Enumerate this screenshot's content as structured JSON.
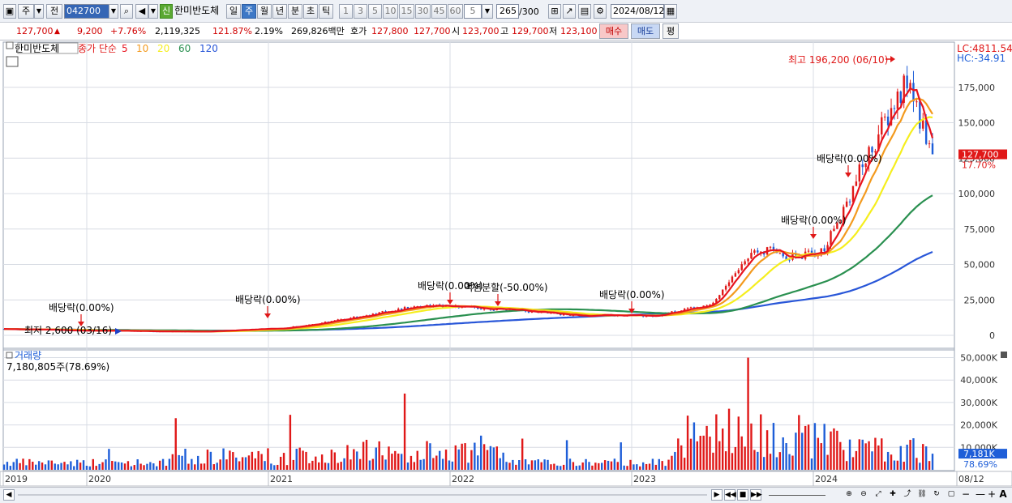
{
  "toolbar": {
    "period_type": "주",
    "prev_label": "전",
    "stock_code": "042700",
    "new_badge": "신",
    "stock_name": "한미반도체",
    "tabs": [
      "일",
      "주",
      "월",
      "년",
      "분",
      "초",
      "틱"
    ],
    "active_tab": "주",
    "intervals": [
      "1",
      "3",
      "5",
      "10",
      "15",
      "30",
      "45",
      "60"
    ],
    "interval_value": "5",
    "count_value": "265",
    "count_total": "/300",
    "date_value": "2024/08/12"
  },
  "quote": {
    "price": "127,700",
    "change": "9,200",
    "change_pct": "+7.76%",
    "volume": "2,119,325",
    "vol_ratio": "121.87%",
    "turnover": "2.19%",
    "amount": "269,826백만",
    "ask_label": "호가",
    "ask1": "127,800",
    "ask2": "127,700",
    "open_label": "시",
    "open": "123,700",
    "high_label": "고",
    "high": "129,700",
    "low_label": "저",
    "low": "123,100",
    "buy_label": "매수",
    "sell_label": "매도",
    "eval_label": "평"
  },
  "legend": {
    "stock_name": "한미반도체",
    "series_label": "종가 단순",
    "ma": [
      {
        "period": "5",
        "color": "#e8141e"
      },
      {
        "period": "10",
        "color": "#f39a1e"
      },
      {
        "period": "20",
        "color": "#f5ee1e"
      },
      {
        "period": "60",
        "color": "#2a9050"
      },
      {
        "period": "120",
        "color": "#2856d8"
      }
    ],
    "lc": "LC:4811.54",
    "hc": "HC:-34.91",
    "volume_title": "거래량",
    "volume_value": "7,180,805주(78.69%)"
  },
  "chart_data": {
    "type": "candlestick",
    "price_axis": {
      "min": 0,
      "max": 200000,
      "ticks": [
        "175,000",
        "150,000",
        "125,000",
        "100,000",
        "75,000",
        "50,000",
        "25,000",
        "0"
      ],
      "tick_values": [
        175000,
        150000,
        125000,
        100000,
        75000,
        50000,
        25000,
        0
      ]
    },
    "volume_axis": {
      "min": 0,
      "max": 52000,
      "ticks": [
        "50,000K",
        "40,000K",
        "30,000K",
        "20,000K",
        "10,000K"
      ],
      "tick_values": [
        50000,
        40000,
        30000,
        20000,
        10000
      ]
    },
    "x_ticks": [
      "2019",
      "2020",
      "2021",
      "2022",
      "2023",
      "2024",
      "08/12"
    ],
    "current_price_label": "127,700",
    "current_pct_label": "17.70%",
    "current_price": 127700,
    "current_volume_label": "7,181K",
    "current_volume_pct": "78.69%",
    "current_volume": 7181,
    "annotations": [
      {
        "text": "최고 196,200 (06/10)",
        "type": "high",
        "price": 196200
      },
      {
        "text": "최저 2,600 (03/16)",
        "type": "low",
        "price": 2600
      },
      {
        "text": "배당락(0.00%)"
      },
      {
        "text": "배당락(0.00%)"
      },
      {
        "text": "배당락(0.00%)"
      },
      {
        "text": "액면분할(-50.00%)"
      },
      {
        "text": "배당락(0.00%)"
      },
      {
        "text": "배당락(0.00%)"
      },
      {
        "text": "배당락(0.00%)"
      }
    ],
    "weekly_close_anchors": [
      {
        "date": "2019-01",
        "close": 4500
      },
      {
        "date": "2019-06",
        "close": 3500
      },
      {
        "date": "2020-03",
        "close": 2600
      },
      {
        "date": "2020-09",
        "close": 5000
      },
      {
        "date": "2020-12",
        "close": 9000
      },
      {
        "date": "2021-07",
        "close": 21000
      },
      {
        "date": "2021-12",
        "close": 19000
      },
      {
        "date": "2022-06",
        "close": 14000
      },
      {
        "date": "2022-12",
        "close": 14000
      },
      {
        "date": "2023-04",
        "close": 23000
      },
      {
        "date": "2023-07",
        "close": 62000
      },
      {
        "date": "2023-10",
        "close": 55000
      },
      {
        "date": "2023-12",
        "close": 60000
      },
      {
        "date": "2024-03",
        "close": 125000
      },
      {
        "date": "2024-06",
        "close": 180000
      },
      {
        "date": "2024-07",
        "close": 150000
      },
      {
        "date": "2024-08",
        "close": 127700
      }
    ],
    "moving_average_end_values": {
      "ma5": 127700,
      "ma10": 150000,
      "ma20": 145000,
      "ma60": 90000,
      "ma120": 52000
    }
  },
  "bottom": {
    "right_label": "A"
  }
}
